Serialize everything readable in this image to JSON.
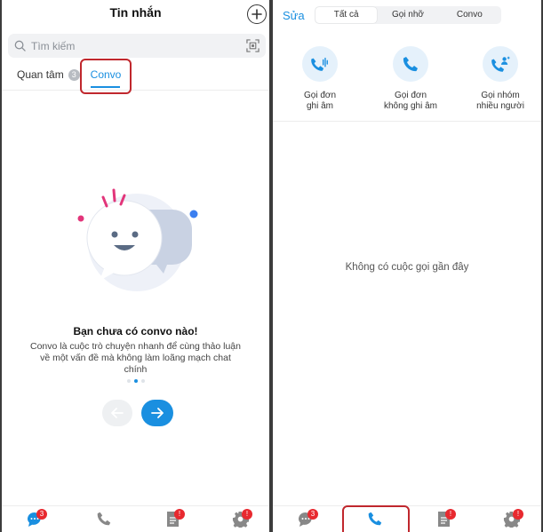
{
  "left": {
    "title": "Tin nhắn",
    "search": {
      "placeholder": "Tìm kiếm"
    },
    "tabs": {
      "focus_label": "Quan tâm",
      "focus_count": "3",
      "convo_label": "Convo"
    },
    "empty": {
      "title": "Bạn chưa có convo nào!",
      "description": "Convo là cuộc trò chuyện nhanh để cùng thảo luận về một vấn đề mà không làm loãng mạch chat chính"
    },
    "carousel": {
      "pages": 3,
      "current": 1
    },
    "bottom_nav": {
      "messages_badge": "3",
      "contacts_badge": "!",
      "settings_badge": "!"
    }
  },
  "right": {
    "edit_label": "Sửa",
    "segments": [
      "Tất cả",
      "Gọi nhỡ",
      "Convo"
    ],
    "active_segment": 0,
    "call_options": [
      {
        "label_line1": "Gọi đơn",
        "label_line2": "ghi âm",
        "icon": "phone-record-icon"
      },
      {
        "label_line1": "Gọi đơn",
        "label_line2": "không ghi âm",
        "icon": "phone-icon"
      },
      {
        "label_line1": "Gọi nhóm",
        "label_line2": "nhiều người",
        "icon": "group-call-icon"
      }
    ],
    "empty_text": "Không có cuộc gọi gần đây",
    "bottom_nav": {
      "messages_badge": "3",
      "contacts_badge": "!",
      "settings_badge": "!"
    }
  },
  "colors": {
    "accent": "#1a8fe0",
    "highlight": "#c0272d",
    "badge": "#e8292f"
  }
}
